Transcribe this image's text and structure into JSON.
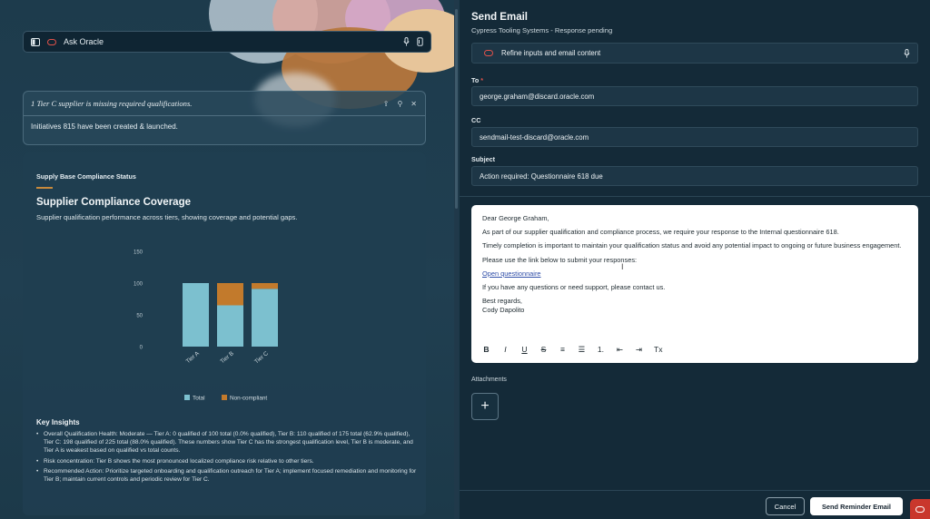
{
  "ask": {
    "placeholder": "Ask Oracle"
  },
  "notification": {
    "title": "1 Tier C supplier is missing required qualifications.",
    "body": "Initiatives 815 have been created & launched."
  },
  "compliance": {
    "section_label": "Supply Base Compliance Status",
    "title": "Supplier Compliance Coverage",
    "subtitle": "Supplier qualification performance across tiers, showing coverage and potential gaps.",
    "insights_title": "Key Insights",
    "insights": [
      "Overall Qualification Health: Moderate — Tier A: 0 qualified of 100 total (0.0% qualified), Tier B: 110 qualified of 175 total (62.9% qualified), Tier C: 198 qualified of 225 total (88.0% qualified). These numbers show Tier C has the strongest qualification level, Tier B is moderate, and Tier A is weakest based on qualified vs total counts.",
      "Risk concentration: Tier B shows the most pronounced localized compliance risk relative to other tiers.",
      "Recommended Action: Prioritize targeted onboarding and qualification outreach for Tier A; implement focused remediation and monitoring for Tier B; maintain current controls and periodic review for Tier C."
    ]
  },
  "chart_data": {
    "type": "bar",
    "stacked": true,
    "categories": [
      "Tier A",
      "Tier B",
      "Tier C"
    ],
    "series": [
      {
        "name": "Total",
        "values": [
          100,
          65,
          91
        ],
        "color": "#7cc0cf"
      },
      {
        "name": "Non-compliant",
        "values": [
          0,
          35,
          9
        ],
        "color": "#c27a2c"
      }
    ],
    "ylim": [
      0,
      150
    ],
    "yticks": [
      "0",
      "50",
      "100",
      "150"
    ],
    "legend": "bottom",
    "grid": false
  },
  "email": {
    "title": "Send Email",
    "subtitle": "Cypress Tooling Systems - Response pending",
    "refine_label": "Refine inputs and email content",
    "to_label": "To",
    "required_mark": "*",
    "to_value": "george.graham@discard.oracle.com",
    "cc_label": "CC",
    "cc_value": "sendmail-test-discard@oracle.com",
    "subject_label": "Subject",
    "subject_value": "Action required: Questionnaire 618 due",
    "body": {
      "greeting": "Dear George Graham,",
      "p1": "As part of our supplier qualification and compliance process, we require your response to the Internal questionnaire 618.",
      "p2": "Timely completion is important to maintain your qualification status and avoid any potential impact to ongoing or future business engagement.",
      "p3": "Please use the link below to submit your responses:",
      "link": "Open questionnaire",
      "p4": "If you have any questions or need support, please contact us.",
      "closing": "Best regards,",
      "signature": "Cody Dapolito"
    },
    "toolbar": [
      "B",
      "I",
      "U",
      "S",
      "≡",
      "☰",
      "1.",
      "⇤",
      "⇥",
      "Tx"
    ],
    "attachments_label": "Attachments",
    "add_symbol": "+",
    "cancel_label": "Cancel",
    "send_label": "Send Reminder Email"
  },
  "colors": {
    "accent_orange": "#c88a3c",
    "oracle_red": "#c9372c"
  }
}
